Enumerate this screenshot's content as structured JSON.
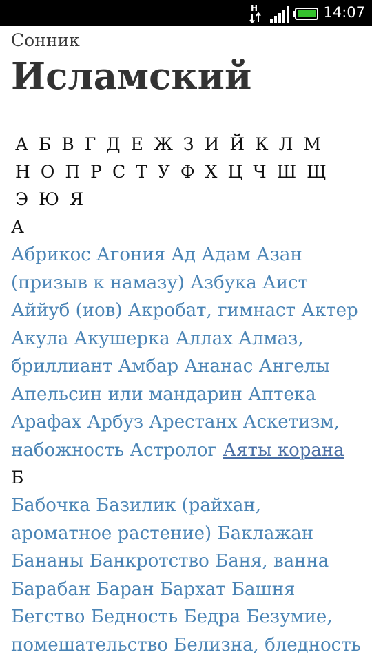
{
  "status": {
    "time": "14:07",
    "network_type": "H",
    "icons": [
      "network-h-icon",
      "signal-icon",
      "battery-icon"
    ]
  },
  "header": {
    "subtitle": "Сонник",
    "title": "Исламский"
  },
  "alphabet": [
    "А",
    "Б",
    "В",
    "Г",
    "Д",
    "Е",
    "Ж",
    "З",
    "И",
    "Й",
    "К",
    "Л",
    "М",
    "Н",
    "О",
    "П",
    "Р",
    "С",
    "Т",
    "У",
    "Ф",
    "Х",
    "Ц",
    "Ч",
    "Ш",
    "Щ",
    "Э",
    "Ю",
    "Я"
  ],
  "sections": [
    {
      "letter": "А",
      "words": [
        "Абрикос",
        "Агония",
        "Ад",
        "Адам",
        "Азан (призыв к намазу)",
        "Азбука",
        "Аист",
        "Аййуб (иов)",
        "Акробат, гимнаст",
        "Актер",
        "Акула",
        "Акушерка",
        "Аллах",
        "Алмаз, бриллиант",
        "Амбар",
        "Ананас",
        "Ангелы",
        "Апельсин или мандарин",
        "Аптека",
        "Арафах",
        "Арбуз",
        "Арестанх",
        "Аскетизм, набожность",
        "Астролог",
        "Аяты корана"
      ]
    },
    {
      "letter": "Б",
      "words": [
        "Бабочка",
        "Базилик (райхан, ароматное растение)",
        "Баклажан",
        "Бананы",
        "Банкротство",
        "Баня, ванна",
        "Барабан",
        "Баран",
        "Бархат",
        "Башня",
        "Бегство",
        "Бедность",
        "Бедра",
        "Безумие, помешательство",
        "Белизна, бледность"
      ]
    }
  ],
  "colors": {
    "link": "#4a84b5",
    "status_bar": "#000000"
  }
}
